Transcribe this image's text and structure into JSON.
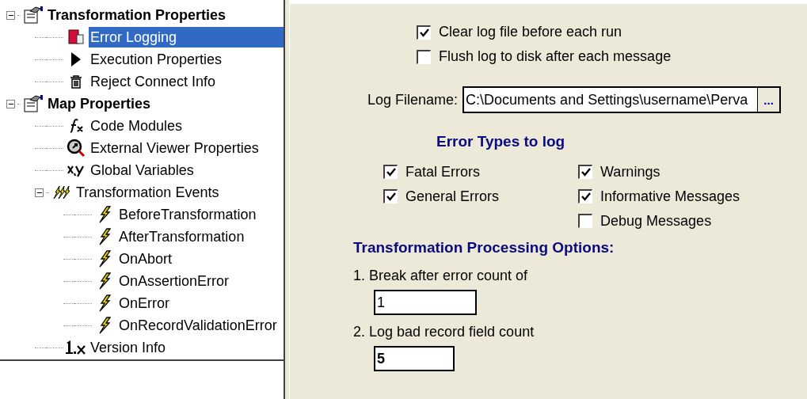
{
  "tree": [
    {
      "label": "Transformation Properties",
      "kind": "properties",
      "bold": true,
      "selected": false,
      "expanded": true,
      "children": [
        {
          "label": "Error Logging",
          "kind": "error-log",
          "selected": true
        },
        {
          "label": "Execution Properties",
          "kind": "play",
          "selected": false
        },
        {
          "label": "Reject Connect Info",
          "kind": "trash",
          "selected": false
        }
      ]
    },
    {
      "label": "Map Properties",
      "kind": "properties",
      "bold": true,
      "selected": false,
      "expanded": true,
      "children": [
        {
          "label": "Code Modules",
          "kind": "fx",
          "selected": false
        },
        {
          "label": "External Viewer Properties",
          "kind": "viewer",
          "selected": false
        },
        {
          "label": "Global Variables",
          "kind": "xy",
          "selected": false
        },
        {
          "label": "Transformation Events",
          "kind": "events",
          "selected": false,
          "expanded": true,
          "children": [
            {
              "label": "BeforeTransformation",
              "kind": "event",
              "selected": false
            },
            {
              "label": "AfterTransformation",
              "kind": "event",
              "selected": false
            },
            {
              "label": "OnAbort",
              "kind": "event",
              "selected": false
            },
            {
              "label": "OnAssertionError",
              "kind": "event",
              "selected": false
            },
            {
              "label": "OnError",
              "kind": "event",
              "selected": false
            },
            {
              "label": "OnRecordValidationError",
              "kind": "event",
              "selected": false
            }
          ]
        },
        {
          "label": "Version Info",
          "kind": "version",
          "selected": false
        }
      ]
    }
  ],
  "log_options": [
    {
      "label": "Clear log file before each run",
      "checked": true
    },
    {
      "label": "Flush log to disk after each message",
      "checked": false
    }
  ],
  "log_filename": {
    "label": "Log Filename:",
    "value": "C:\\Documents and Settings\\username\\Perva",
    "browse": "..."
  },
  "error_types": {
    "title": "Error Types to log",
    "column_1": [
      {
        "label": "Fatal Errors",
        "checked": true
      },
      {
        "label": "General Errors",
        "checked": true
      }
    ],
    "column_2": [
      {
        "label": "Warnings",
        "checked": true
      },
      {
        "label": "Informative Messages",
        "checked": true
      },
      {
        "label": "Debug Messages",
        "checked": false
      }
    ]
  },
  "processing": {
    "title": "Transformation Processing Options:",
    "options": [
      {
        "label": "1. Break after error count of",
        "value": "1",
        "bold": false
      },
      {
        "label": "2. Log bad record field count",
        "value": "5",
        "bold": true
      }
    ]
  }
}
